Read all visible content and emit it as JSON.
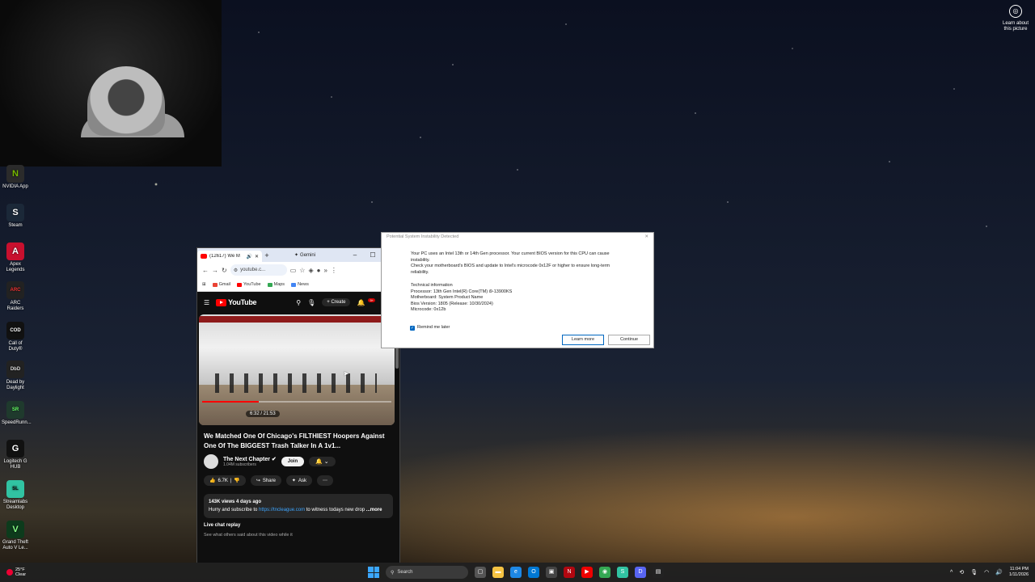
{
  "desktop": {
    "learn_picture_line1": "Learn about",
    "learn_picture_line2": "this picture",
    "icons": [
      {
        "label1": "NVIDIA App",
        "label2": "",
        "color": "#2b2b2b",
        "glyph": "N",
        "glyph_color": "#76b900"
      },
      {
        "label1": "Steam",
        "label2": "",
        "color": "#1b2838",
        "glyph": "S",
        "glyph_color": "#fff"
      },
      {
        "label1": "Apex",
        "label2": "Legends",
        "color": "#c8102e",
        "glyph": "A",
        "glyph_color": "#fff"
      },
      {
        "label1": "ARC Raiders",
        "label2": "",
        "color": "#222",
        "glyph": "ARC",
        "glyph_color": "#e33"
      },
      {
        "label1": "Call of",
        "label2": "Duty®",
        "color": "#111",
        "glyph": "COD",
        "glyph_color": "#fff"
      },
      {
        "label1": "Dead by",
        "label2": "Daylight",
        "color": "#222",
        "glyph": "DbD",
        "glyph_color": "#ddd"
      },
      {
        "label1": "SpeedRunn...",
        "label2": "",
        "color": "#1f3a2d",
        "glyph": "SR",
        "glyph_color": "#6f6"
      },
      {
        "label1": "Logitech G",
        "label2": "HUB",
        "color": "#111",
        "glyph": "G",
        "glyph_color": "#fff"
      },
      {
        "label1": "Streamlabs",
        "label2": "Desktop",
        "color": "#31c3a2",
        "glyph": "SL",
        "glyph_color": "#111"
      },
      {
        "label1": "Grand Theft",
        "label2": "Auto V Le...",
        "color": "#0d3b1c",
        "glyph": "V",
        "glyph_color": "#8f8"
      }
    ]
  },
  "browser": {
    "tab_title": "(12617) We M",
    "new_tab": "+",
    "gemini_label": "Gemini",
    "url": "youtube.c...",
    "bookmarks": [
      {
        "label": "Gmail",
        "color": "#ea4335"
      },
      {
        "label": "YouTube",
        "color": "#ff0000"
      },
      {
        "label": "Maps",
        "color": "#34a853"
      },
      {
        "label": "News",
        "color": "#4285f4"
      }
    ]
  },
  "youtube": {
    "logo_text": "YouTube",
    "create_label": "Create",
    "notif_count": "9+",
    "video_time": "6:32 / 21:53",
    "progress": 0.3,
    "title": "We Matched One Of Chicago's FILTHIEST Hoopers Against One Of The BIGGEST Trash Talker In A 1v1...",
    "channel_name": "The Next Chapter",
    "subscribers": "1.04M subscribers",
    "join_label": "Join",
    "likes": "6.7K",
    "share_label": "Share",
    "ask_label": "Ask",
    "views_date": "143K views  4 days ago",
    "desc_prefix": "Hurry and subscribe to ",
    "desc_link": "https://tncleague.com",
    "desc_suffix": " to witness todays new drop",
    "more_label": " ...more",
    "live_chat_title": "Live chat replay",
    "live_chat_sub": "See what others said about this video while it"
  },
  "dialog": {
    "title": "Potential System Instability Detected",
    "para1_line1": "Your PC uses an Intel 13th or 14th Gen processor. Your current BIOS version for this CPU can cause instability.",
    "para1_line2": "Check your motherboard's BIOS and update to Intel's microcode 0x12F or higher to ensure long-term reliability.",
    "tech_heading": "Technical information",
    "processor": "Processor: 13th Gen Intel(R) Core(TM) i9-13900KS",
    "motherboard": "Motherboard: System Product Name",
    "bios": "Bios Version: 1805 (Release: 10/30/2024)",
    "microcode": "Microcode: 0x12b",
    "remind_label": "Remind me later",
    "learn_more_label": "Learn more",
    "continue_label": "Continue"
  },
  "taskbar": {
    "temp": "25°F",
    "condition": "Clear",
    "search_placeholder": "Search",
    "time": "11:04 PM",
    "date": "1/11/2026",
    "apps": [
      {
        "name": "file-explorer",
        "color": "#f5c343",
        "glyph": "▬"
      },
      {
        "name": "edge",
        "color": "#1e88e5",
        "glyph": "e"
      },
      {
        "name": "outlook",
        "color": "#0078d4",
        "glyph": "O"
      },
      {
        "name": "app-dark",
        "color": "#444",
        "glyph": "▣"
      },
      {
        "name": "netflix",
        "color": "#b20710",
        "glyph": "N"
      },
      {
        "name": "youtube",
        "color": "#e00",
        "glyph": "▶"
      },
      {
        "name": "chrome",
        "color": "#34a853",
        "glyph": "◉"
      },
      {
        "name": "streamlabs",
        "color": "#31c3a2",
        "glyph": "S"
      },
      {
        "name": "discord",
        "color": "#5865f2",
        "glyph": "D"
      },
      {
        "name": "terminal",
        "color": "#222",
        "glyph": "▤"
      }
    ]
  }
}
